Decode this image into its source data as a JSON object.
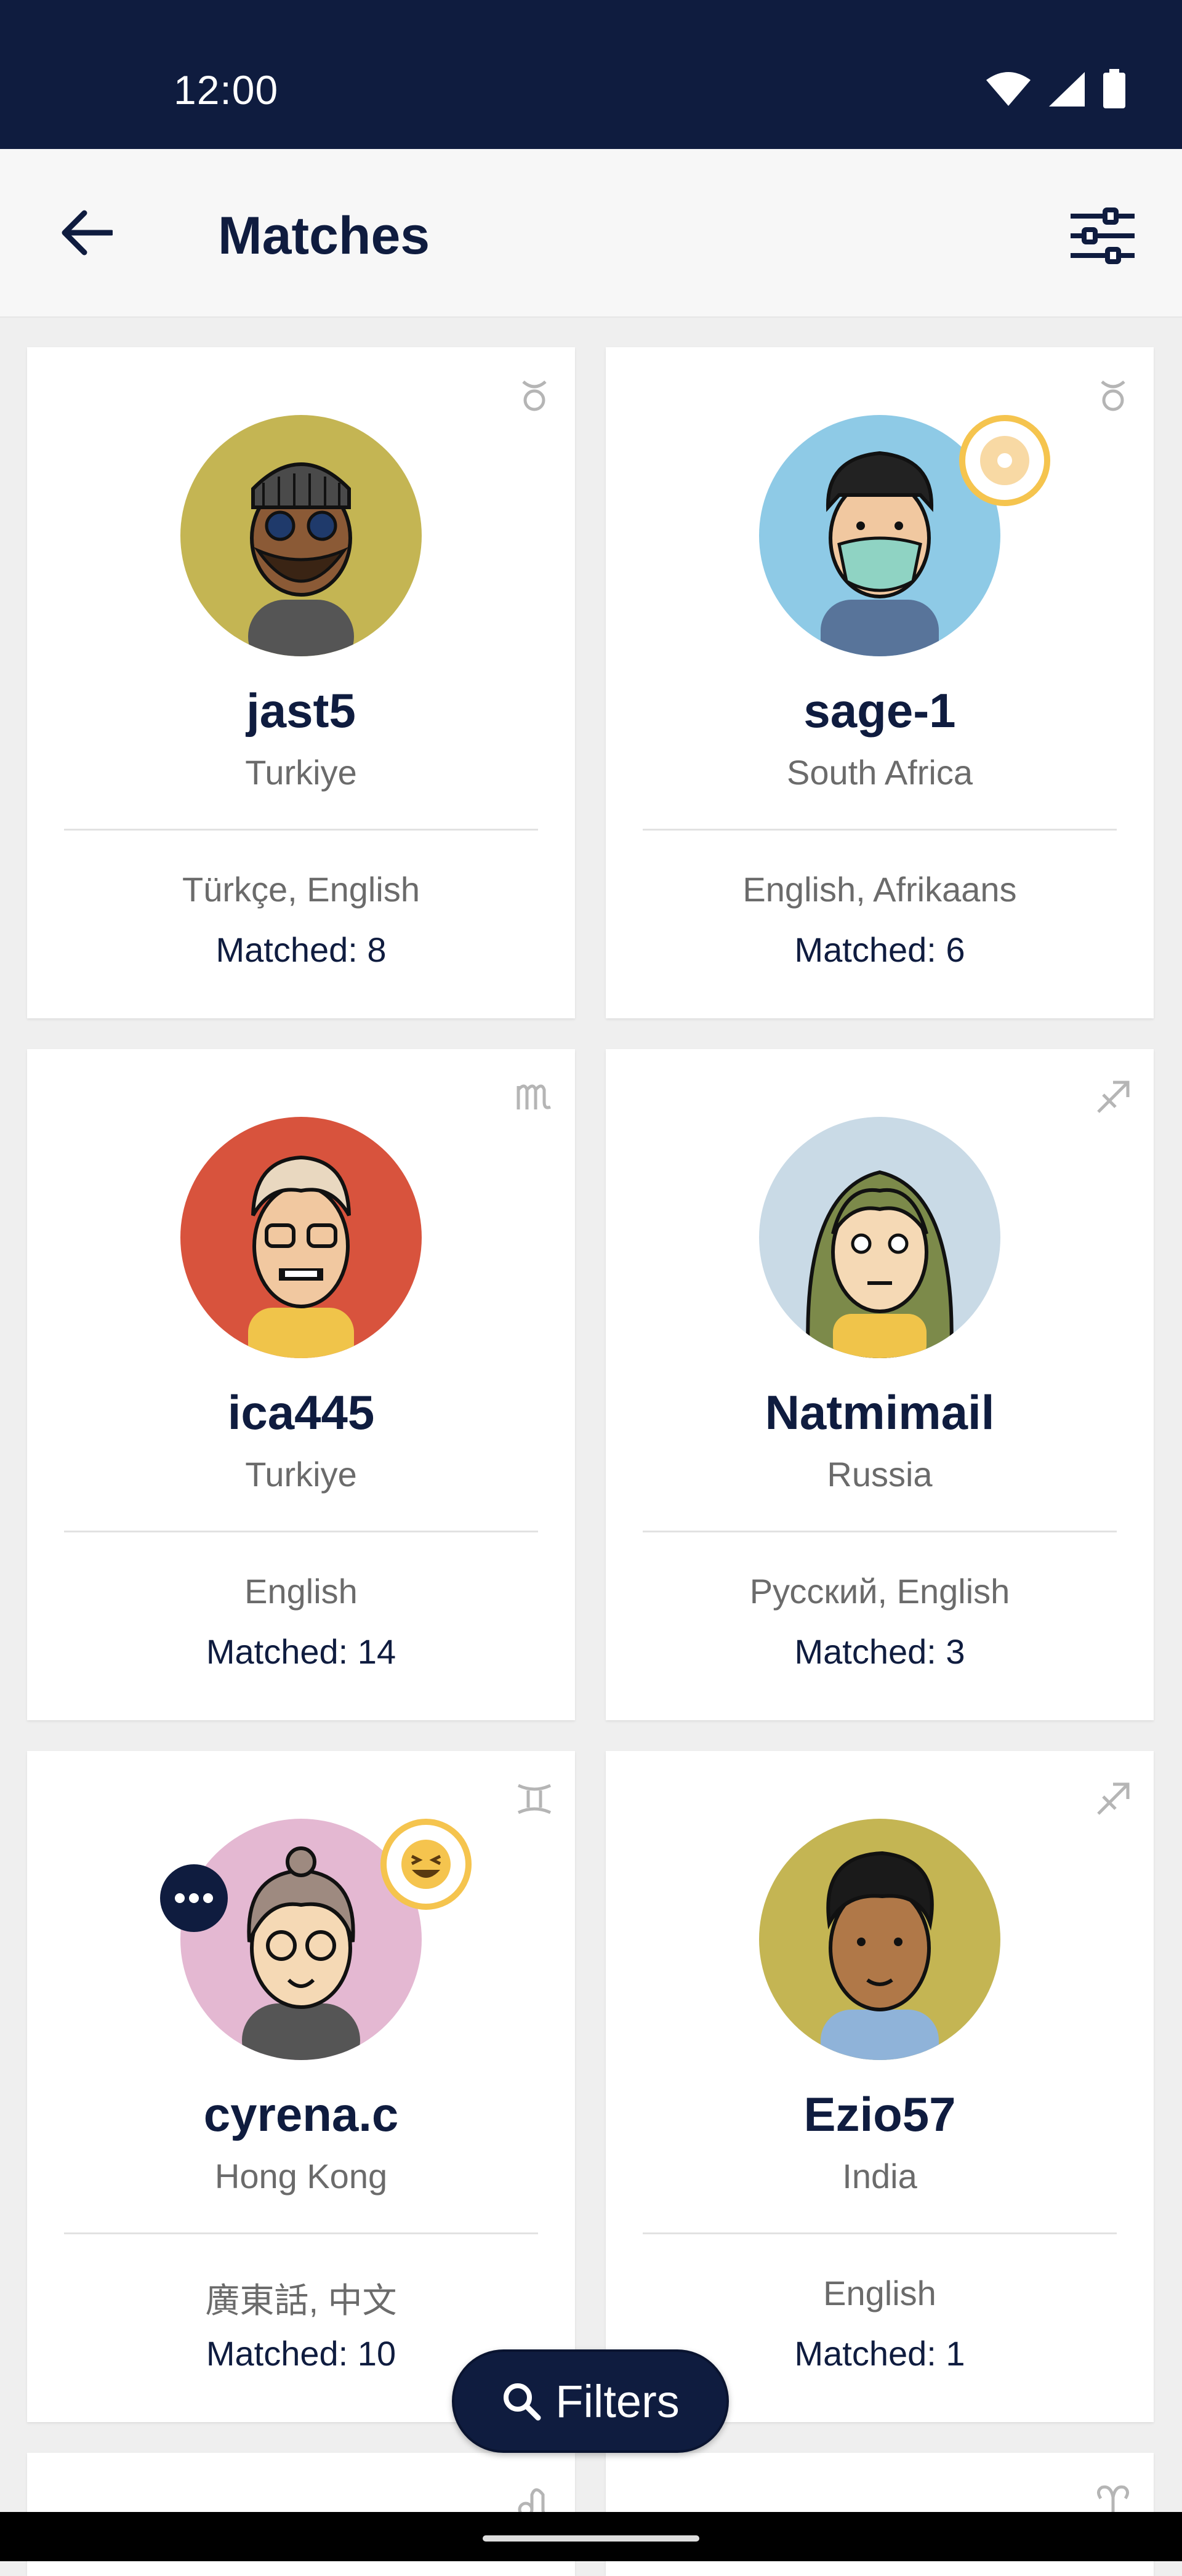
{
  "status_bar": {
    "time": "12:00"
  },
  "app_bar": {
    "title": "Matches"
  },
  "matches": [
    {
      "username": "jast5",
      "country": "Turkiye",
      "languages": "Türkçe, English",
      "matched": "Matched: 8",
      "zodiac": "♉"
    },
    {
      "username": "sage-1",
      "country": "South Africa",
      "languages": "English, Afrikaans",
      "matched": "Matched: 6",
      "zodiac": "♉"
    },
    {
      "username": "ica445",
      "country": "Turkiye",
      "languages": "English",
      "matched": "Matched: 14",
      "zodiac": "♍"
    },
    {
      "username": "Natmimail",
      "country": "Russia",
      "languages": "Русский, English",
      "matched": "Matched: 3",
      "zodiac": "♐"
    },
    {
      "username": "cyrena.c",
      "country": "Hong Kong",
      "languages": "廣東話, 中文",
      "matched": "Matched: 10",
      "zodiac": "♊"
    },
    {
      "username": "Ezio57",
      "country": "India",
      "languages": "English",
      "matched": "Matched: 1",
      "zodiac": "♐"
    }
  ],
  "partial_cards": [
    {
      "zodiac": "♌"
    },
    {
      "zodiac": "♈"
    }
  ],
  "fab": {
    "label": "Filters"
  },
  "colors": {
    "primary": "#0f1c3f",
    "badge_ring": "#f5c44e",
    "background": "#efefef"
  }
}
